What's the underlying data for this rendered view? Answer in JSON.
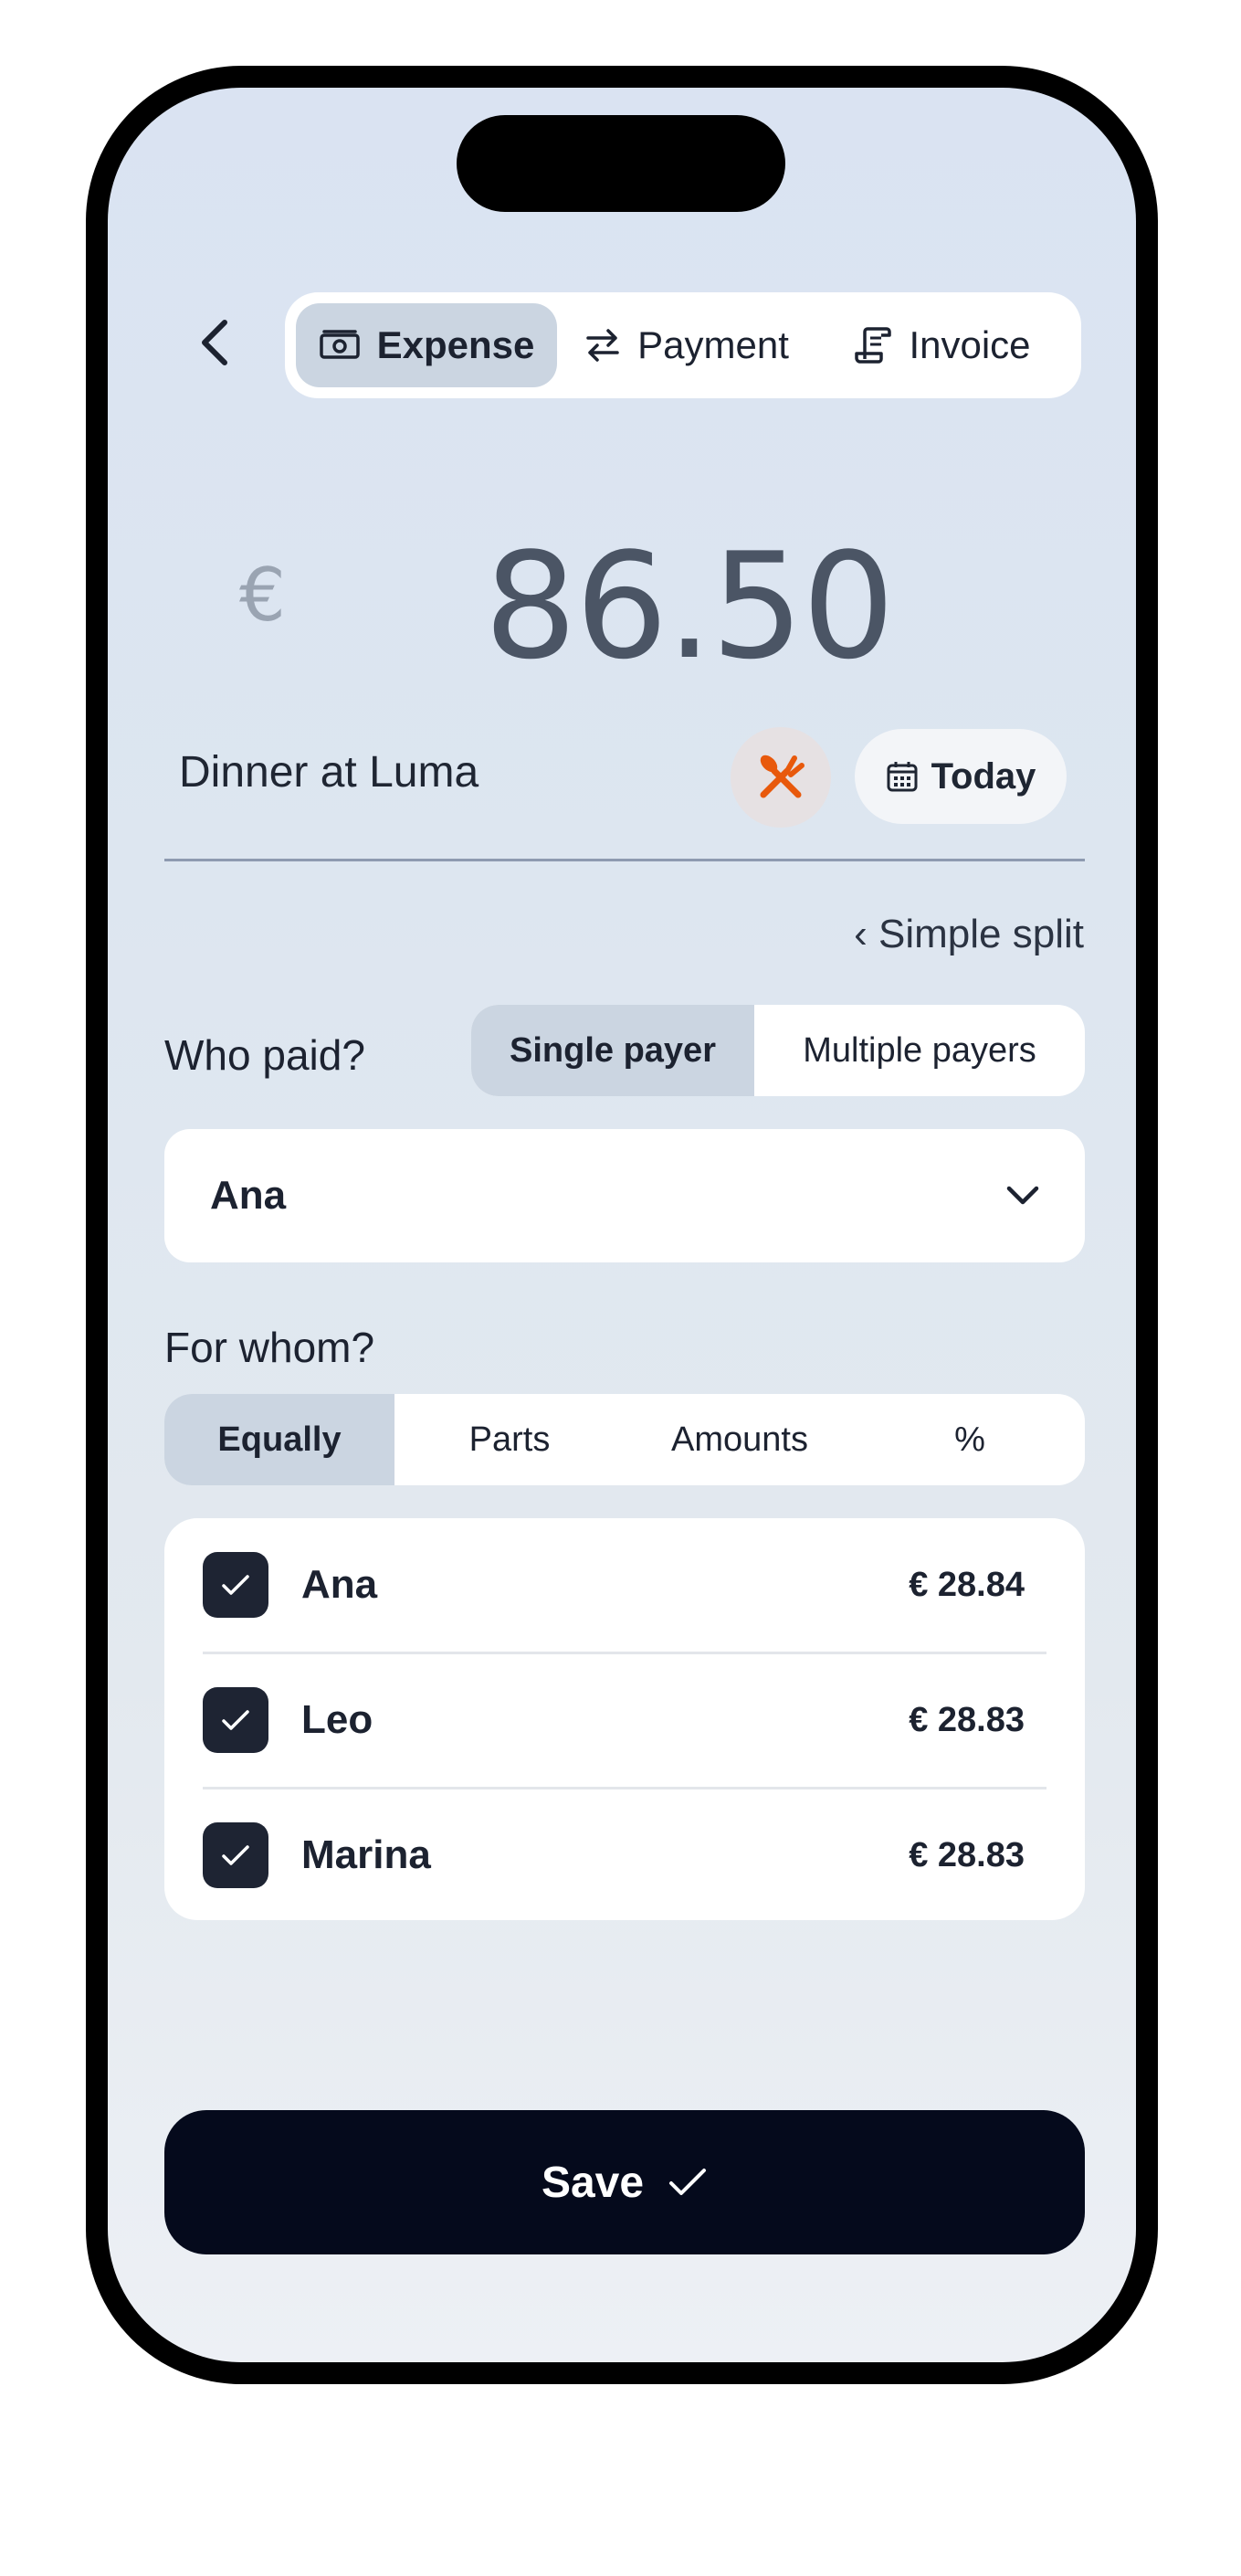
{
  "header": {
    "back_icon": "chevron-left-icon",
    "tabs": [
      {
        "label": "Expense",
        "icon": "banknote-icon",
        "active": true
      },
      {
        "label": "Payment",
        "icon": "arrows-swap-icon",
        "active": false
      },
      {
        "label": "Invoice",
        "icon": "receipt-icon",
        "active": false
      }
    ]
  },
  "amount": {
    "currency_symbol": "€",
    "value": "86.50"
  },
  "details": {
    "description": "Dinner at Luma",
    "category_icon": "utensils-icon",
    "category_color": "#e8590c",
    "date_icon": "calendar-icon",
    "date_label": "Today"
  },
  "split_mode_link": "‹ Simple split",
  "who_paid": {
    "label": "Who paid?",
    "options": [
      "Single payer",
      "Multiple payers"
    ],
    "selected_option": "Single payer",
    "payer": "Ana",
    "dropdown_icon": "chevron-down-icon"
  },
  "for_whom": {
    "label": "For whom?",
    "tabs": [
      "Equally",
      "Parts",
      "Amounts",
      "%"
    ],
    "selected_tab": "Equally",
    "members": [
      {
        "name": "Ana",
        "share": "€ 28.84",
        "checked": true
      },
      {
        "name": "Leo",
        "share": "€ 28.83",
        "checked": true
      },
      {
        "name": "Marina",
        "share": "€ 28.83",
        "checked": true
      }
    ]
  },
  "save": {
    "label": "Save",
    "icon": "check-icon"
  },
  "colors": {
    "accent_dark": "#050a1c",
    "active_segment": "#cbd5e1"
  }
}
